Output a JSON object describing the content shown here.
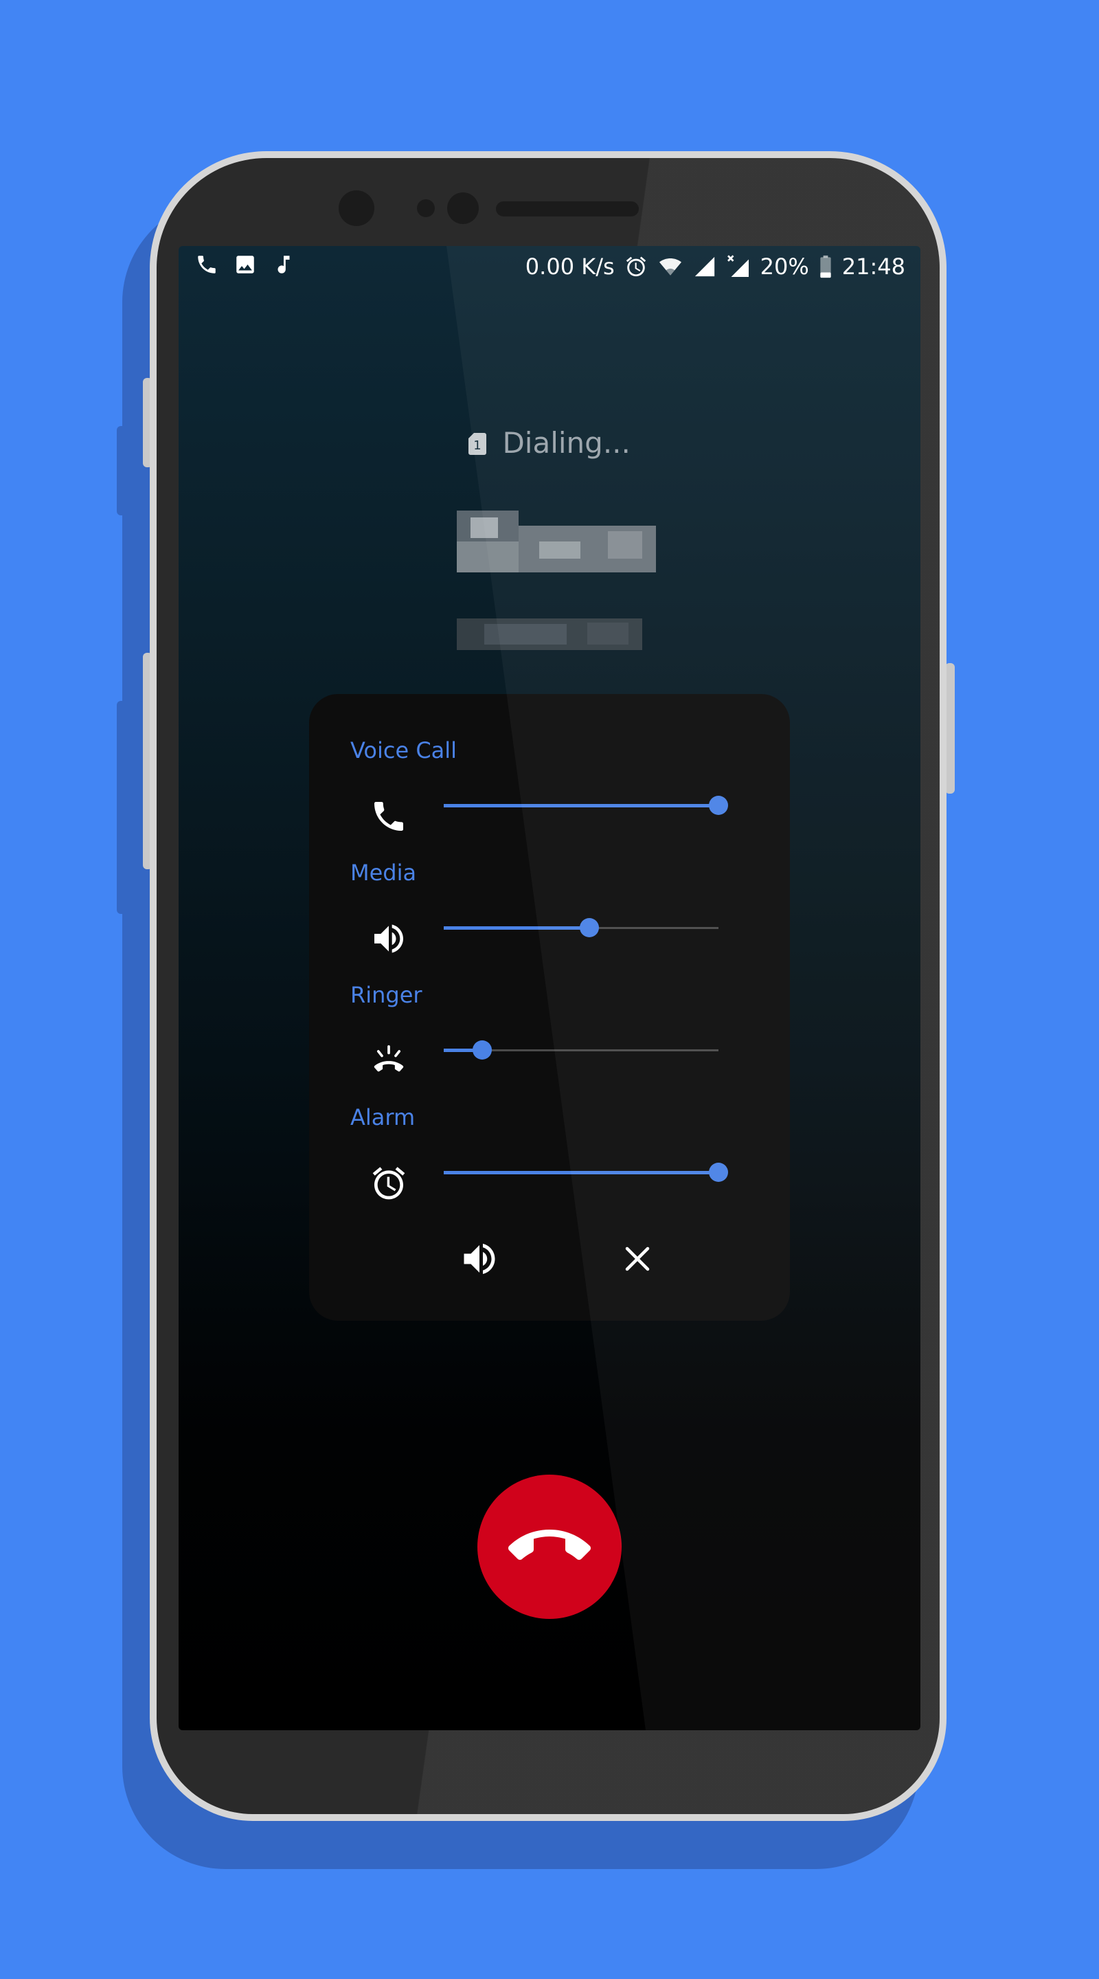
{
  "status_bar": {
    "left_icons": [
      "phone-icon",
      "image-icon",
      "music-note-icon"
    ],
    "net_speed": "0.00 K/s",
    "right_icons": [
      "alarm-icon",
      "wifi-icon",
      "signal-icon",
      "signal-no-data-icon",
      "battery-icon"
    ],
    "battery": "20%",
    "time": "21:48"
  },
  "call": {
    "sim_badge": "1",
    "status": "Dialing..."
  },
  "volume_panel": {
    "streams": [
      {
        "label": "Voice Call",
        "icon": "phone-icon",
        "level": 1.0
      },
      {
        "label": "Media",
        "icon": "speaker-icon",
        "level": 0.53
      },
      {
        "label": "Ringer",
        "icon": "ringer-icon",
        "level": 0.14
      },
      {
        "label": "Alarm",
        "icon": "alarm-clock-icon",
        "level": 1.0
      }
    ],
    "bottom_icons": [
      "speaker-icon",
      "close-icon"
    ]
  },
  "colors": {
    "background": "#4285f4",
    "accent": "#4a82e6",
    "end_call": "#d0021b",
    "panel": "#0d0d0d"
  }
}
